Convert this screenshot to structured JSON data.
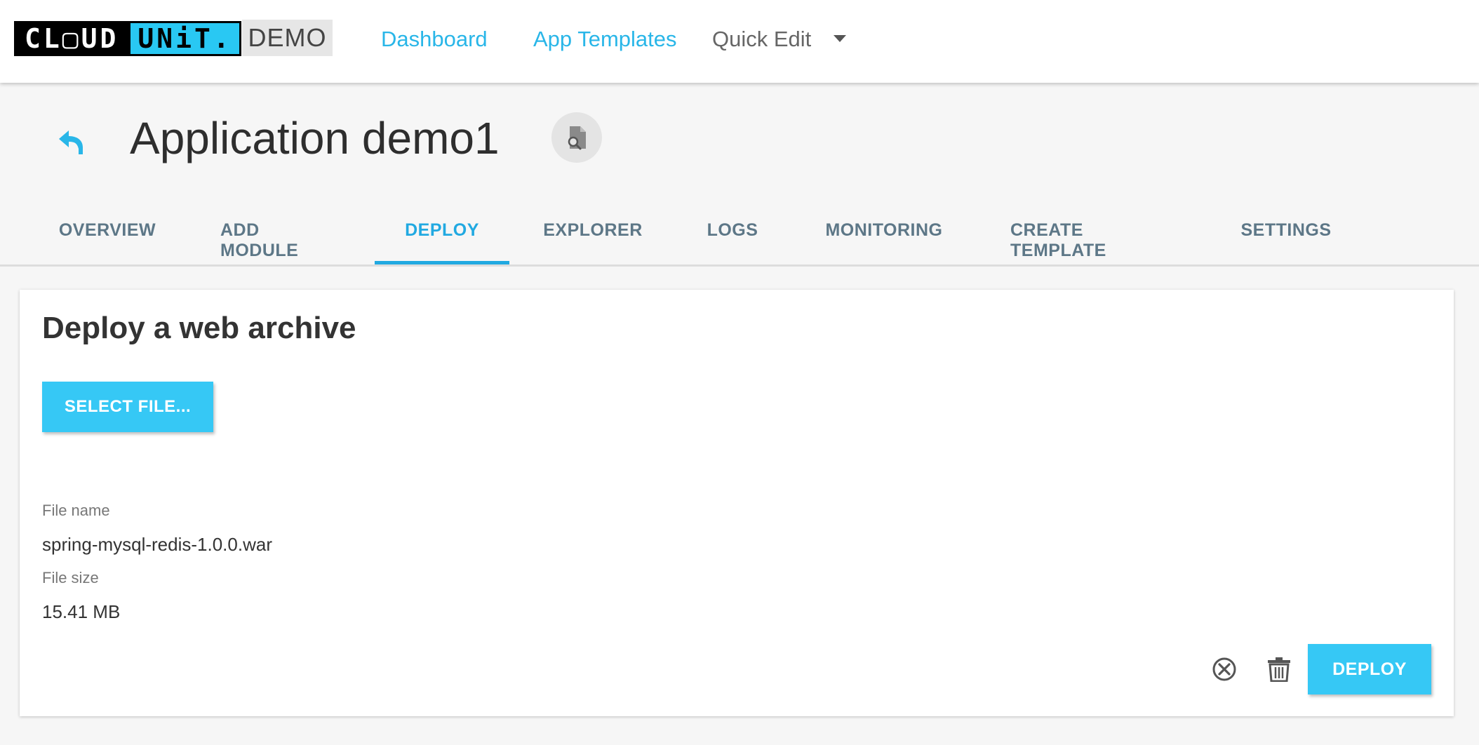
{
  "logo": {
    "part1": "CL▢UD",
    "part2": "UNiT.",
    "badge": "DEMO"
  },
  "nav": {
    "dashboard": "Dashboard",
    "app_templates": "App Templates",
    "quick_edit": "Quick Edit"
  },
  "header": {
    "title": "Application demo1"
  },
  "tabs": [
    {
      "label": "OVERVIEW"
    },
    {
      "label": "ADD MODULE"
    },
    {
      "label": "DEPLOY",
      "active": true
    },
    {
      "label": "EXPLORER"
    },
    {
      "label": "LOGS"
    },
    {
      "label": "MONITORING"
    },
    {
      "label": "CREATE TEMPLATE"
    },
    {
      "label": "SETTINGS"
    }
  ],
  "deploy": {
    "title": "Deploy a web archive",
    "select_file_label": "SELECT FILE...",
    "file_name_label": "File name",
    "file_name_value": "spring-mysql-redis-1.0.0.war",
    "file_size_label": "File size",
    "file_size_value": "15.41 MB",
    "deploy_label": "DEPLOY"
  },
  "colors": {
    "accent": "#21a9e1",
    "button": "#36c8f5",
    "tab_text": "#5d7787"
  },
  "icons": {
    "back": "back-arrow-icon",
    "doc": "document-search-icon",
    "cancel": "cancel-circle-icon",
    "delete": "trash-icon"
  }
}
